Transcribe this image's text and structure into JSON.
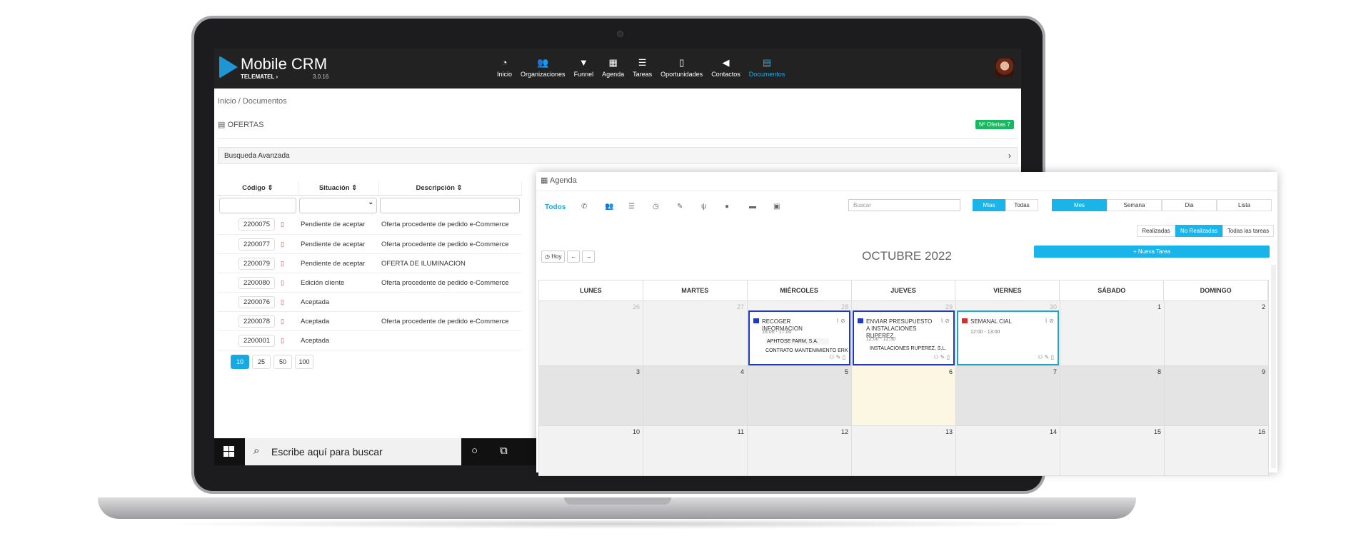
{
  "app": {
    "title": "Mobile CRM",
    "company": "TELEMATEL ›",
    "version": "3.0.16"
  },
  "nav": [
    {
      "label": "Inicio",
      "icon": "dashboard-icon",
      "glyph": "◔"
    },
    {
      "label": "Organizaciones",
      "icon": "users-icon",
      "glyph": "👥"
    },
    {
      "label": "Funnel",
      "icon": "funnel-icon",
      "glyph": "▼"
    },
    {
      "label": "Agenda",
      "icon": "calendar-icon",
      "glyph": "▦"
    },
    {
      "label": "Tareas",
      "icon": "tasks-icon",
      "glyph": "☰"
    },
    {
      "label": "Oportunidades",
      "icon": "phone-icon",
      "glyph": "▯"
    },
    {
      "label": "Contactos",
      "icon": "megaphone-icon",
      "glyph": "◀"
    },
    {
      "label": "Documentos",
      "icon": "document-icon",
      "glyph": "▤"
    }
  ],
  "breadcrumb": {
    "home": "Inicio /",
    "current": "Documentos"
  },
  "page": {
    "title": "OFERTAS",
    "badge": "Nº Ofertas 7",
    "advanced_search": "Busqueda Avanzada"
  },
  "table": {
    "headers": [
      "Código ⇕",
      "Situación ⇕",
      "Descripción ⇕"
    ],
    "rows": [
      {
        "code": "2200075",
        "status": "Pendiente de aceptar",
        "desc": "Oferta procedente de pedido e-Commerce"
      },
      {
        "code": "2200077",
        "status": "Pendiente de aceptar",
        "desc": "Oferta procedente de pedido e-Commerce"
      },
      {
        "code": "2200079",
        "status": "Pendiente de aceptar",
        "desc": "OFERTA DE ILUMINACION"
      },
      {
        "code": "2200080",
        "status": "Edición cliente",
        "desc": "Oferta procedente de pedido e-Commerce"
      },
      {
        "code": "2200076",
        "status": "Aceptada",
        "desc": ""
      },
      {
        "code": "2200078",
        "status": "Aceptada",
        "desc": "Oferta procedente de pedido e-Commerce"
      },
      {
        "code": "2200001",
        "status": "Aceptada",
        "desc": ""
      }
    ],
    "page_sizes": [
      "10",
      "25",
      "50",
      "100"
    ]
  },
  "taskbar": {
    "search_placeholder": "Escribe aquí para buscar"
  },
  "agenda": {
    "title": "Agenda",
    "filter_all": "Todos",
    "search_placeholder": "Buscar",
    "owner": [
      "Mias",
      "Todas"
    ],
    "views": [
      "Mes",
      "Semana",
      "Dia",
      "Lista"
    ],
    "status": [
      "Realizadas",
      "No Realizadas",
      "Todas las tareas"
    ],
    "today": "Hoy",
    "month": "OCTUBRE 2022",
    "new_task": "+ Nueva Tarea",
    "days": [
      "LUNES",
      "MARTES",
      "MIÉRCOLES",
      "JUEVES",
      "VIERNES",
      "SÁBADO",
      "DOMINGO"
    ],
    "weeks": [
      [
        "26",
        "27",
        "28",
        "29",
        "30",
        "1",
        "2"
      ],
      [
        "3",
        "4",
        "5",
        "6",
        "7",
        "8",
        "9"
      ],
      [
        "10",
        "11",
        "12",
        "13",
        "14",
        "15",
        "16"
      ]
    ],
    "events": [
      {
        "title": "RECOGER INFORMACION",
        "time": "16:00 - 17:00",
        "client": "APHTOSE FARM, S.A.",
        "contract": "CONTRATO MANTENIMIENTO ERK"
      },
      {
        "title": "ENVIAR PRESUPUESTO A INSTALACIONES RUPEREZ",
        "time": "12:00 - 12:30",
        "client": "INSTALACIONES RUPEREZ, S.L."
      },
      {
        "title": "SEMANAL CIAL",
        "time": "12:00 - 13:00"
      }
    ]
  }
}
